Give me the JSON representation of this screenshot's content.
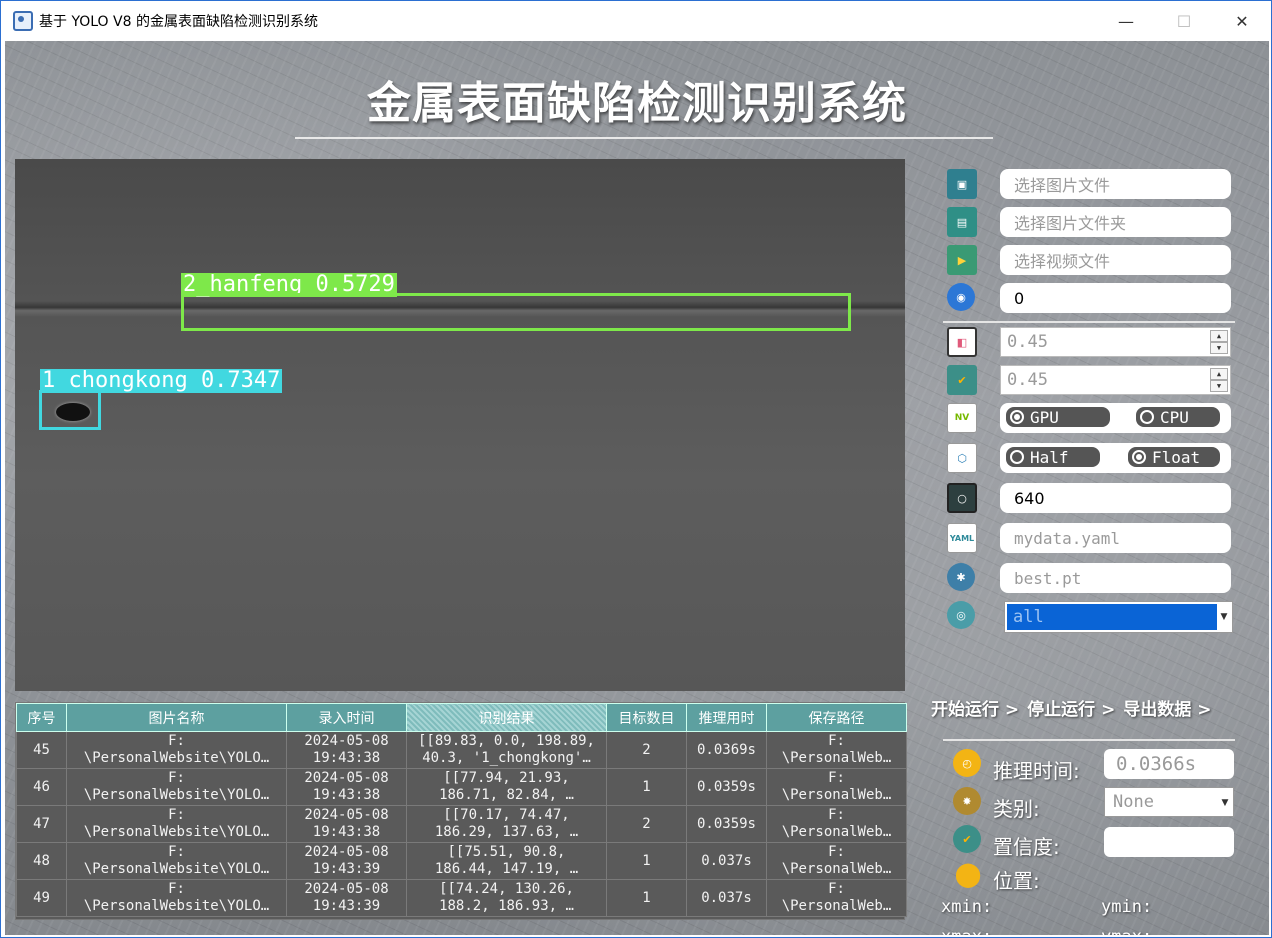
{
  "window": {
    "title": "基于 YOLO V8 的金属表面缺陷检测识别系统",
    "minimize": "—",
    "maximize": "☐",
    "close": "✕"
  },
  "main_title": "金属表面缺陷检测识别系统",
  "detections": [
    {
      "label": "2_hanfeng 0.5729",
      "color": "#7ee84a"
    },
    {
      "label": "1_chongkong 0.7347",
      "color": "#41d8e0"
    }
  ],
  "table": {
    "headers": [
      "序号",
      "图片名称",
      "录入时间",
      "识别结果",
      "目标数目",
      "推理用时",
      "保存路径"
    ],
    "rows": [
      [
        "45",
        "F:",
        "\\PersonalWebsite\\YOLO…",
        "2024-05-08",
        "19:43:38",
        "[[89.83, 0.0, 198.89,",
        "40.3, '1_chongkong'…",
        "2",
        "0.0369s",
        "F:",
        "\\PersonalWeb…"
      ],
      [
        "46",
        "F:",
        "\\PersonalWebsite\\YOLO…",
        "2024-05-08",
        "19:43:38",
        "[[77.94, 21.93,",
        "186.71, 82.84, …",
        "1",
        "0.0359s",
        "F:",
        "\\PersonalWeb…"
      ],
      [
        "47",
        "F:",
        "\\PersonalWebsite\\YOLO…",
        "2024-05-08",
        "19:43:38",
        "[[70.17, 74.47,",
        "186.29, 137.63, …",
        "2",
        "0.0359s",
        "F:",
        "\\PersonalWeb…"
      ],
      [
        "48",
        "F:",
        "\\PersonalWebsite\\YOLO…",
        "2024-05-08",
        "19:43:39",
        "[[75.51, 90.8,",
        "186.44, 147.19, …",
        "1",
        "0.037s",
        "F:",
        "\\PersonalWeb…"
      ],
      [
        "49",
        "F:",
        "\\PersonalWebsite\\YOLO…",
        "2024-05-08",
        "19:43:39",
        "[[74.24, 130.26,",
        "188.2, 186.93, …",
        "1",
        "0.037s",
        "F:",
        "\\PersonalWeb…"
      ]
    ]
  },
  "panel": {
    "select_image": "选择图片文件",
    "select_folder": "选择图片文件夹",
    "select_video": "选择视频文件",
    "camera": "0",
    "iou": "0.45",
    "conf": "0.45",
    "device": {
      "gpu": "GPU",
      "cpu": "CPU",
      "selected": "GPU"
    },
    "precision": {
      "half": "Half",
      "float": "Float",
      "selected": "Float"
    },
    "imgsz": "640",
    "yaml": "mydata.yaml",
    "weights": "best.pt",
    "class_filter": "all",
    "start": "开始运行 >",
    "stop": "停止运行 >",
    "export": "导出数据 >",
    "infer_time_label": "推理时间:",
    "infer_time": "0.0366s",
    "class_label": "类别:",
    "class_value": "None",
    "conf_label": "置信度:",
    "conf_value": "",
    "pos_label": "位置:",
    "xmin": "xmin:",
    "ymin": "ymin:",
    "xmax": "xmax:",
    "ymax": "ymax:"
  },
  "icons": [
    "image-icon",
    "folder-icon",
    "video-icon",
    "camera-icon",
    "iou-icon",
    "confidence-icon",
    "nvidia-icon",
    "cube-icon",
    "size-icon",
    "yaml-icon",
    "weights-icon",
    "target-icon",
    "clock-icon",
    "gear-icon",
    "badge-icon",
    "location-icon"
  ]
}
